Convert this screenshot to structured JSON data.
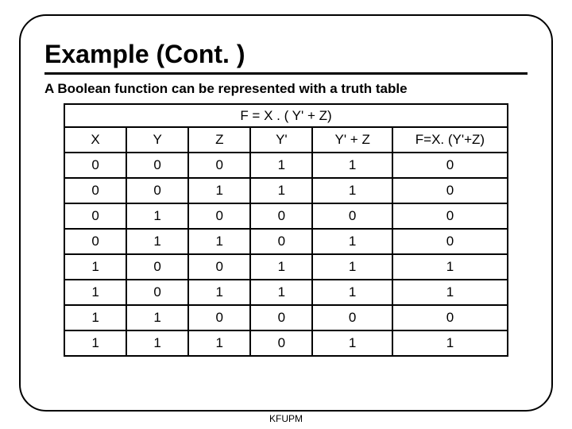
{
  "title": "Example (Cont. )",
  "subtitle": "A Boolean function can be represented with a truth table",
  "footer": "KFUPM",
  "chart_data": {
    "type": "table",
    "caption": "F = X . ( Y' + Z)",
    "headers": [
      "X",
      "Y",
      "Z",
      "Y'",
      "Y' + Z",
      "F=X. (Y'+Z)"
    ],
    "rows": [
      [
        "0",
        "0",
        "0",
        "1",
        "1",
        "0"
      ],
      [
        "0",
        "0",
        "1",
        "1",
        "1",
        "0"
      ],
      [
        "0",
        "1",
        "0",
        "0",
        "0",
        "0"
      ],
      [
        "0",
        "1",
        "1",
        "0",
        "1",
        "0"
      ],
      [
        "1",
        "0",
        "0",
        "1",
        "1",
        "1"
      ],
      [
        "1",
        "0",
        "1",
        "1",
        "1",
        "1"
      ],
      [
        "1",
        "1",
        "0",
        "0",
        "0",
        "0"
      ],
      [
        "1",
        "1",
        "1",
        "0",
        "1",
        "1"
      ]
    ]
  }
}
